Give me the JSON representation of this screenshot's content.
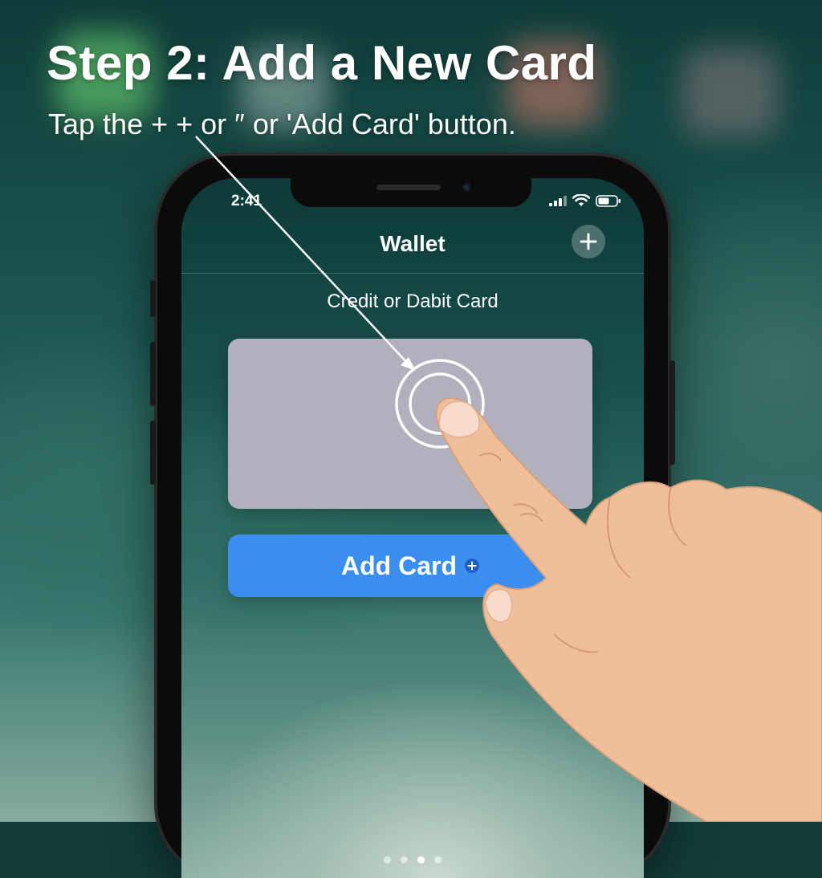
{
  "tutorial": {
    "heading": "Step 2: Add a New Card",
    "instruction": "Tap the + + or ″ or 'Add Card' button."
  },
  "status_bar": {
    "time": "2:41",
    "icons": [
      "signal-icon",
      "wifi-icon",
      "battery-icon"
    ]
  },
  "nav": {
    "title": "Wallet",
    "add_icon": "plus-icon"
  },
  "section": {
    "label": "Credit or Dabit Card"
  },
  "card_placeholder": {
    "color": "#b1b1bd"
  },
  "add_card_button": {
    "label": "Add Card",
    "icon": "plus-circle-icon",
    "color": "#3a8ef0"
  },
  "page_indicator": {
    "count": 4,
    "active_index": 2
  },
  "annotations": {
    "tap_target_icon": "tap-rings-icon",
    "pointer": "pointing-hand"
  }
}
